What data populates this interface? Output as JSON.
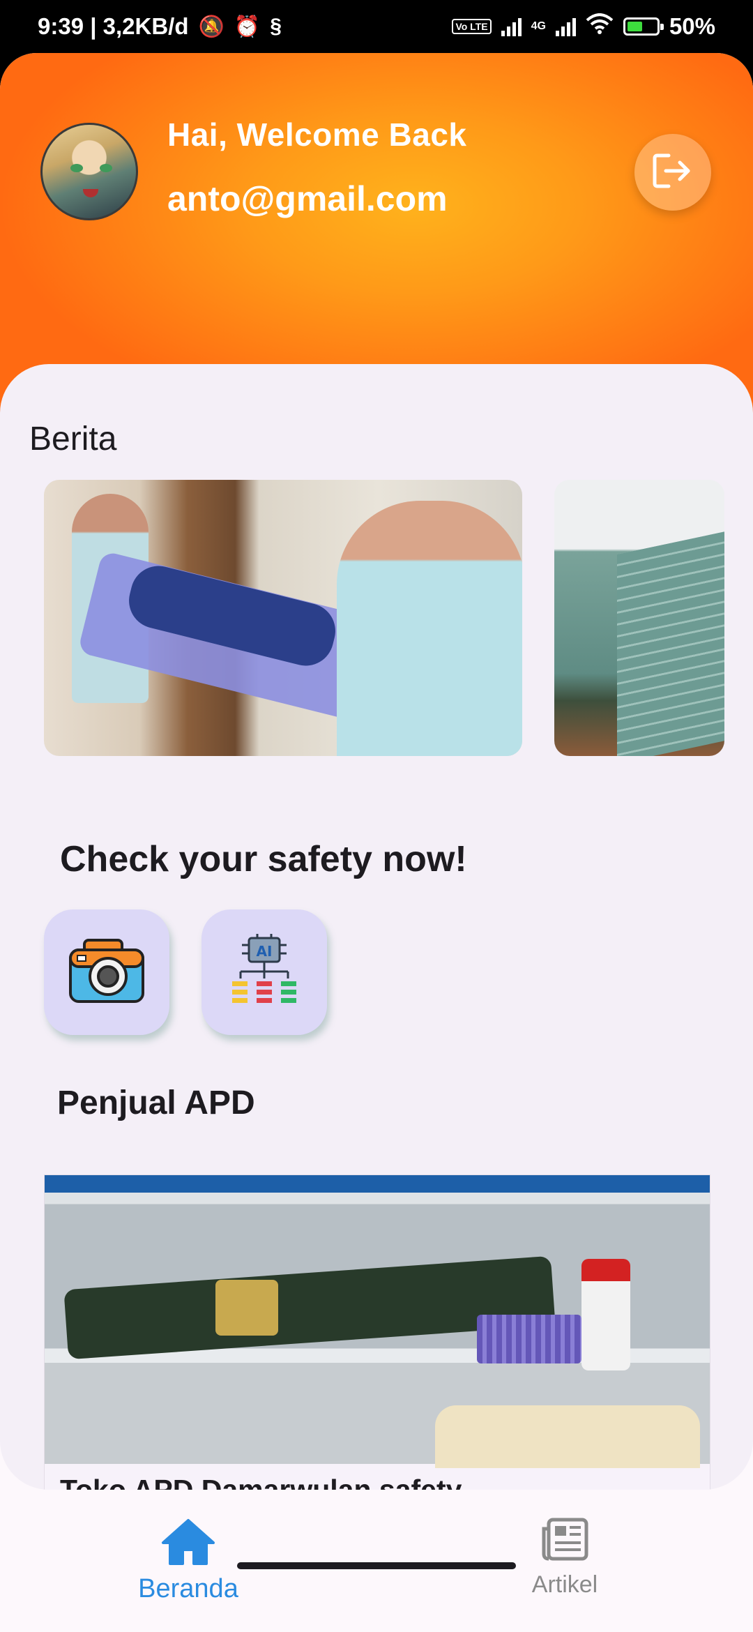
{
  "status_bar": {
    "time_speed": "9:39 | 3,2KB/d",
    "network": "4G",
    "volte": "Vo LTE",
    "battery": "50%",
    "battery_level": 0.5
  },
  "header": {
    "greeting": "Hai, Welcome Back",
    "email": "anto@gmail.com",
    "avatar_icon": "avatar-anime-character",
    "logout_icon": "logout-icon"
  },
  "sections": {
    "berita": "Berita",
    "check": "Check your safety now!",
    "penjual": "Penjual APD"
  },
  "news": [
    {
      "image": "stretcher-patient-photo"
    },
    {
      "image": "building-photo"
    }
  ],
  "tools": [
    {
      "icon": "camera-icon"
    },
    {
      "icon": "ai-chip-icon",
      "label": "AI"
    }
  ],
  "shop": {
    "name": "Toko APD Damarwulan safety"
  },
  "bottom_nav": {
    "items": [
      {
        "label": "Beranda",
        "icon": "home-icon",
        "active": true
      },
      {
        "label": "Artikel",
        "icon": "newspaper-icon",
        "active": false
      }
    ]
  },
  "colors": {
    "header_orange": "#ff7a14",
    "accent_blue": "#2a8be0",
    "tool_bg": "#dcd8f7"
  }
}
